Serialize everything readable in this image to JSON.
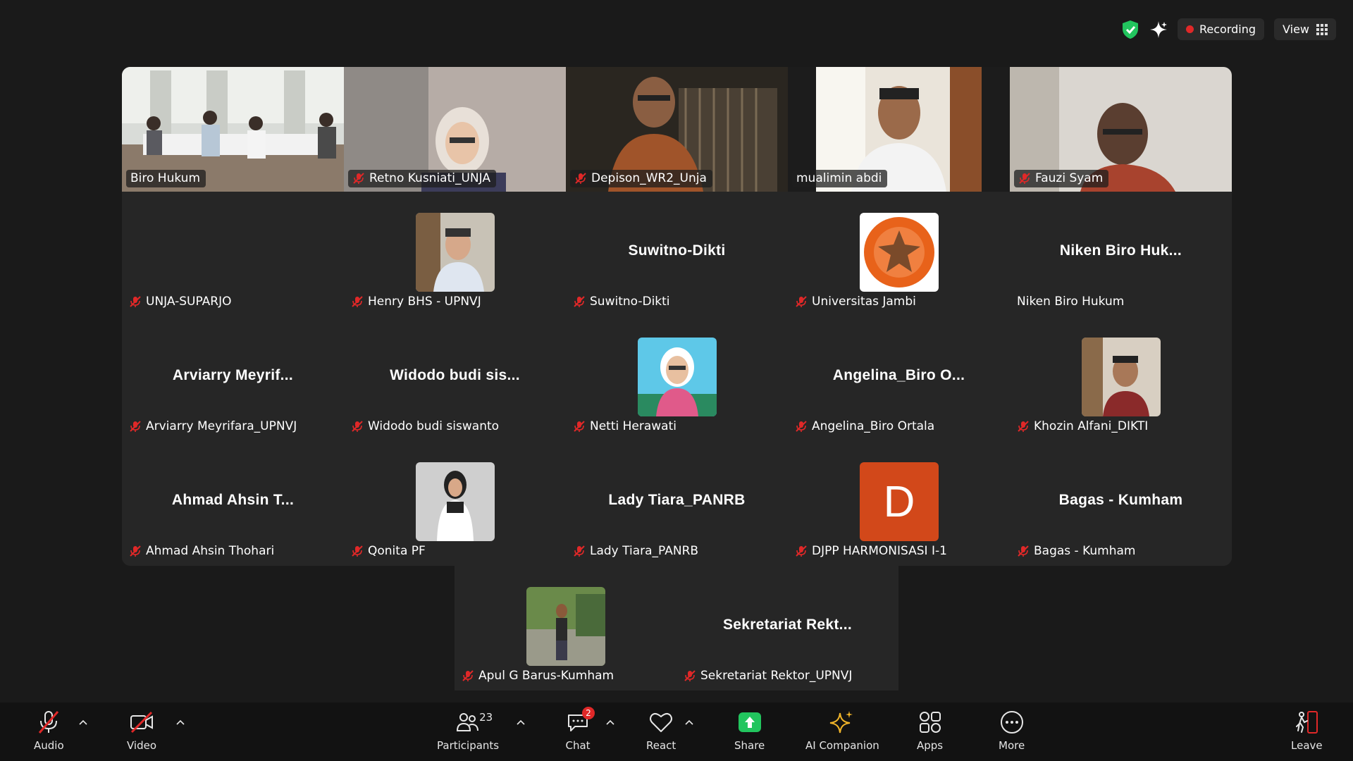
{
  "top_bar": {
    "recording_label": "Recording",
    "view_label": "View",
    "colors": {
      "recording": "#e02828",
      "shield": "#22c55e"
    }
  },
  "video_row": [
    {
      "name": "Biro Hukum",
      "muted": false,
      "scene": "room"
    },
    {
      "name": "Retno Kusniati_UNJA",
      "muted": true,
      "scene": "woman"
    },
    {
      "name": "Depison_WR2_Unja",
      "muted": true,
      "scene": "man-batik"
    },
    {
      "name": "mualimin abdi",
      "muted": false,
      "scene": "man-office",
      "active": true
    },
    {
      "name": "Fauzi Syam",
      "muted": true,
      "scene": "man-light"
    }
  ],
  "grid_rows": [
    [
      {
        "name": "UNJA-SUPARJO",
        "display": "",
        "muted": true
      },
      {
        "name": "Henry BHS - UPNVJ",
        "display": "",
        "muted": true,
        "avatar": "photo-man"
      },
      {
        "name": "Suwitno-Dikti",
        "display": "Suwitno-Dikti",
        "muted": true
      },
      {
        "name": "Universitas Jambi",
        "display": "",
        "muted": true,
        "avatar": "logo-unja"
      },
      {
        "name": "Niken Biro Hukum",
        "display": "Niken Biro Huk...",
        "muted": false
      }
    ],
    [
      {
        "name": "Arviarry Meyrifara_UPNVJ",
        "display": "Arviarry  Meyrif...",
        "muted": true
      },
      {
        "name": "Widodo budi siswanto",
        "display": "Widodo  budi  sis...",
        "muted": true
      },
      {
        "name": "Netti Herawati",
        "display": "",
        "muted": true,
        "avatar": "photo-hijab"
      },
      {
        "name": "Angelina_Biro Ortala",
        "display": "Angelina_Biro  O...",
        "muted": true
      },
      {
        "name": "Khozin Alfani_DIKTI",
        "display": "",
        "muted": true,
        "avatar": "photo-young"
      }
    ],
    [
      {
        "name": "Ahmad Ahsin Thohari",
        "display": "Ahmad  Ahsin  T...",
        "muted": true
      },
      {
        "name": "Qonita PF",
        "display": "",
        "muted": true,
        "avatar": "photo-qonita"
      },
      {
        "name": "Lady Tiara_PANRB",
        "display": "Lady Tiara_PANRB",
        "muted": true
      },
      {
        "name": "DJPP HARMONISASI I-1",
        "display": "",
        "muted": true,
        "avatar": "letter-d",
        "avatar_letter": "D"
      },
      {
        "name": "Bagas - Kumham",
        "display": "Bagas - Kumham",
        "muted": true
      }
    ]
  ],
  "last_row": [
    {
      "name": "Apul G Barus-Kumham",
      "display": "",
      "muted": true,
      "avatar": "photo-park"
    },
    {
      "name": "Sekretariat Rektor_UPNVJ",
      "display": "Sekretariat  Rekt...",
      "muted": true
    }
  ],
  "toolbar": {
    "audio": "Audio",
    "video": "Video",
    "participants": "Participants",
    "participants_count": "23",
    "chat": "Chat",
    "chat_badge": "2",
    "react": "React",
    "share": "Share",
    "ai_companion": "AI Companion",
    "apps": "Apps",
    "more": "More",
    "leave": "Leave",
    "colors": {
      "share": "#22c55e",
      "leave": "#e02828"
    }
  }
}
